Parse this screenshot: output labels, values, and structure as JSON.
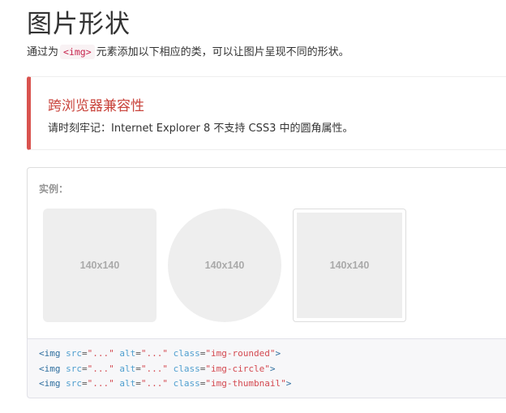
{
  "page": {
    "title": "图片形状",
    "intro_before": "通过为",
    "intro_code": "<img>",
    "intro_after": "元素添加以下相应的类，可以让图片呈现不同的形状。"
  },
  "callout": {
    "title": "跨浏览器兼容性",
    "text": "请时刻牢记：Internet Explorer 8 不支持 CSS3 中的圆角属性。",
    "accent_color": "#d9534f"
  },
  "example": {
    "label": "实例：",
    "images": [
      {
        "text": "140x140",
        "shape": "rounded"
      },
      {
        "text": "140x140",
        "shape": "circle"
      },
      {
        "text": "140x140",
        "shape": "thumbnail"
      }
    ]
  },
  "code": {
    "lines": [
      {
        "tag": "<img",
        "attr_src": "src",
        "eq1": "=",
        "src": "\"...\"",
        "attr_alt": "alt",
        "eq2": "=",
        "alt": "\"...\"",
        "attr_class": "class",
        "eq3": "=",
        "cls": "\"img-rounded\"",
        "close": ">"
      },
      {
        "tag": "<img",
        "attr_src": "src",
        "eq1": "=",
        "src": "\"...\"",
        "attr_alt": "alt",
        "eq2": "=",
        "alt": "\"...\"",
        "attr_class": "class",
        "eq3": "=",
        "cls": "\"img-circle\"",
        "close": ">"
      },
      {
        "tag": "<img",
        "attr_src": "src",
        "eq1": "=",
        "src": "\"...\"",
        "attr_alt": "alt",
        "eq2": "=",
        "alt": "\"...\"",
        "attr_class": "class",
        "eq3": "=",
        "cls": "\"img-thumbnail\"",
        "close": ">"
      }
    ]
  }
}
